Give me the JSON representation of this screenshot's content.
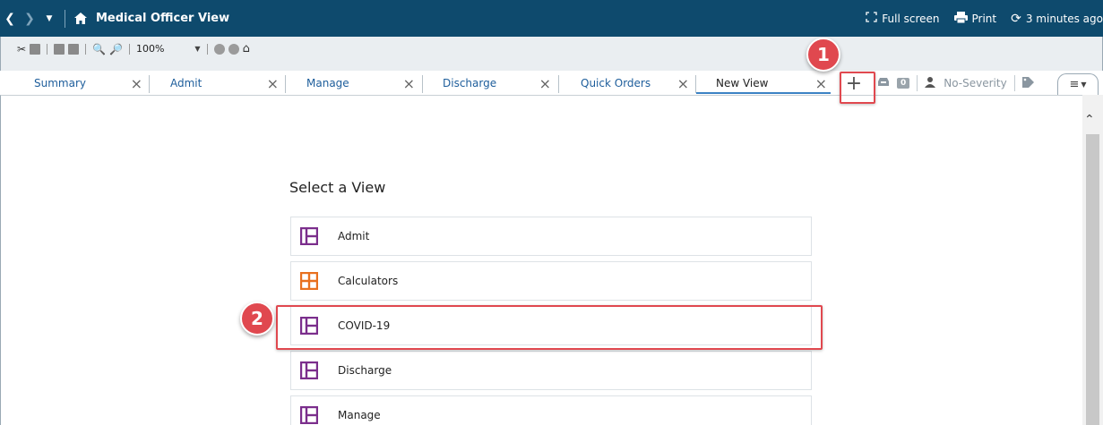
{
  "titlebar": {
    "title": "Medical Officer View",
    "fullscreen_label": "Full screen",
    "print_label": "Print",
    "refresh_label": "3 minutes ago"
  },
  "toolbar": {
    "zoom": "100%"
  },
  "tabs": [
    {
      "label": "Summary"
    },
    {
      "label": "Admit"
    },
    {
      "label": "Manage"
    },
    {
      "label": "Discharge"
    },
    {
      "label": "Quick Orders"
    },
    {
      "label": "New View"
    }
  ],
  "right_tools": {
    "count": "0",
    "severity": "No-Severity"
  },
  "main": {
    "heading": "Select a View",
    "views": [
      {
        "label": "Admit",
        "icon": "layout-icon",
        "color": "#7b2e8c"
      },
      {
        "label": "Calculators",
        "icon": "grid-icon",
        "color": "#e8701f"
      },
      {
        "label": "COVID-19",
        "icon": "layout-icon",
        "color": "#7b2e8c"
      },
      {
        "label": "Discharge",
        "icon": "layout-icon",
        "color": "#7b2e8c"
      },
      {
        "label": "Manage",
        "icon": "layout-icon",
        "color": "#7b2e8c"
      }
    ]
  },
  "callouts": [
    {
      "number": "1"
    },
    {
      "number": "2"
    }
  ],
  "colors": {
    "titlebar": "#0e4a6d",
    "callout": "#e0484f",
    "tab_link": "#1d5d9b"
  }
}
